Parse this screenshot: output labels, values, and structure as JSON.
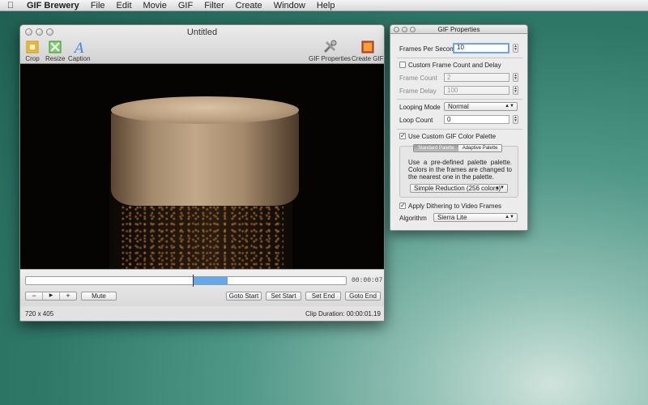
{
  "menubar": {
    "apple_icon": "apple-icon",
    "app_name": "GIF Brewery",
    "items": [
      "File",
      "Edit",
      "Movie",
      "GIF",
      "Filter",
      "Create",
      "Window",
      "Help"
    ]
  },
  "main_window": {
    "title": "Untitled",
    "toolbar": {
      "crop": "Crop",
      "resize": "Resize",
      "caption": "Caption",
      "gif_properties": "GIF Properties",
      "create_gif": "Create GIF"
    },
    "timeline": {
      "timecode": "00:00:07",
      "buttons": {
        "minus": "−",
        "play": "▶",
        "plus": "+",
        "mute": "Mute",
        "goto_start": "Goto Start",
        "set_start": "Set Start",
        "set_end": "Set End",
        "goto_end": "Goto End"
      }
    },
    "status": {
      "dimensions": "720 x 405",
      "clip_duration": "Clip Duration: 00:00:01.19"
    }
  },
  "panel": {
    "title": "GIF Properties",
    "fps_label": "Frames Per Second",
    "fps_value": "10",
    "custom_frame_label": "Custom Frame Count and Delay",
    "frame_count_label": "Frame Count",
    "frame_count_value": "2",
    "frame_delay_label": "Frame Delay",
    "frame_delay_value": "100",
    "looping_mode_label": "Looping Mode",
    "looping_mode_value": "Normal",
    "loop_count_label": "Loop Count",
    "loop_count_value": "0",
    "custom_palette_label": "Use Custom GIF Color Palette",
    "tabs": [
      "Standard Palette",
      "Adaptive Palette"
    ],
    "palette_description": "Use a pre-defined palette palette. Colors in the frames are changed to the nearest one in the palette.",
    "palette_select": "Simple Reduction (256 colors)",
    "dithering_label": "Apply Dithering to Video Frames",
    "algorithm_label": "Algorithm",
    "algorithm_value": "Sierra Lite"
  },
  "colors": {
    "accent": "#64a8ec",
    "desktop": "#2f7868"
  }
}
